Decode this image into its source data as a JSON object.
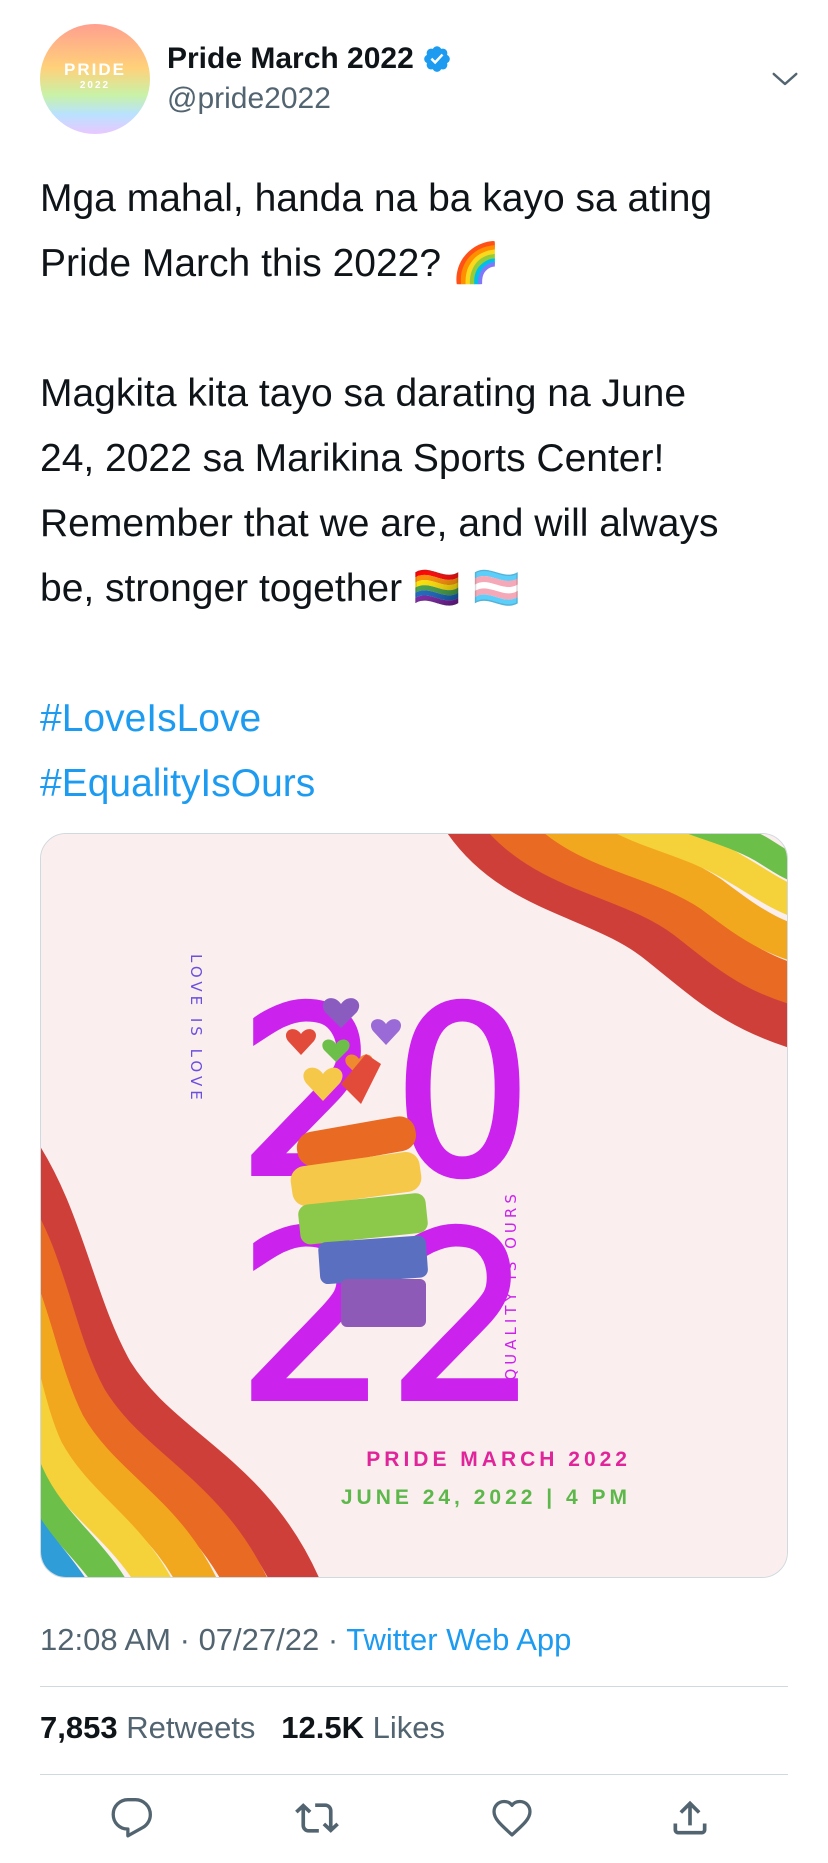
{
  "author": {
    "display_name": "Pride March 2022",
    "handle": "@pride2022",
    "avatar_text": "PRIDE",
    "avatar_year": "2022",
    "verified_icon": "verified-badge-icon",
    "menu_icon": "chevron-down-icon"
  },
  "tweet": {
    "lines": [
      "Mga mahal, handa na ba kayo sa ating",
      "Pride March this 2022? 🌈",
      "Magkita kita tayo sa darating na June",
      "24, 2022 sa Marikina Sports Center!",
      "Remember that we are, and will always",
      "be, stronger together 🏳️‍🌈 🏳️‍⚧️"
    ],
    "hashtags": [
      "#LoveIsLove",
      "#EqualityIsOurs"
    ]
  },
  "media": {
    "year": "2022",
    "side_left": "LOVE IS LOVE",
    "side_right": "EQUALITY IS OURS",
    "event_title": "PRIDE MARCH 2022",
    "event_date": "JUNE 24, 2022 | 4 PM"
  },
  "meta": {
    "time": "12:08 AM",
    "date": "07/27/22",
    "source": "Twitter Web App",
    "separator": "·"
  },
  "stats": {
    "retweets_count": "7,853",
    "retweets_label": "Retweets",
    "likes_count": "12.5K",
    "likes_label": "Likes"
  },
  "actions": [
    "reply-icon",
    "retweet-icon",
    "like-icon",
    "share-icon"
  ],
  "colors": {
    "link": "#1d9bf0",
    "text": "#0f1419",
    "muted": "#536471",
    "poster_magenta": "#cc22ee",
    "poster_pink": "#e0249a",
    "poster_green": "#5cb84a"
  }
}
